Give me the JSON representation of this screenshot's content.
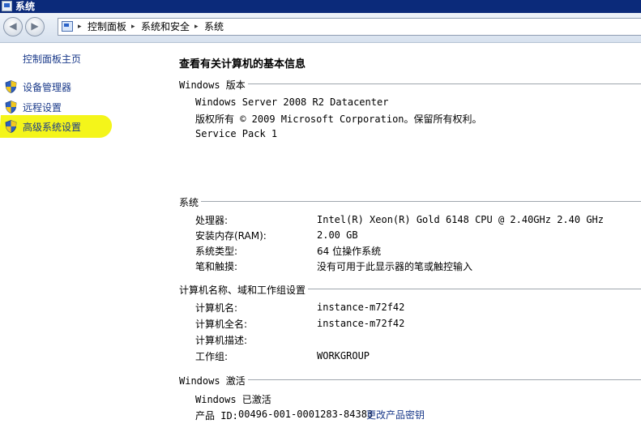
{
  "window": {
    "title": "系统"
  },
  "nav": {
    "breadcrumb": [
      "控制面板",
      "系统和安全",
      "系统"
    ],
    "separator": "▸"
  },
  "left": {
    "home": "控制面板主页",
    "items": [
      {
        "label": "设备管理器",
        "icon": "shield-icon"
      },
      {
        "label": "远程设置",
        "icon": "shield-icon"
      },
      {
        "label": "高级系统设置",
        "icon": "shield-icon",
        "highlighted": true
      }
    ]
  },
  "main": {
    "heading": "查看有关计算机的基本信息",
    "edition": {
      "title": "Windows 版本",
      "lines": [
        "Windows Server 2008 R2 Datacenter",
        "版权所有 © 2009 Microsoft Corporation。保留所有权利。",
        "Service Pack 1"
      ]
    },
    "system": {
      "title": "系统",
      "rows": [
        {
          "label": "处理器:",
          "value": "Intel(R) Xeon(R) Gold 6148 CPU @ 2.40GHz   2.40 GHz"
        },
        {
          "label": "安装内存(RAM):",
          "value": "2.00 GB"
        },
        {
          "label": "系统类型:",
          "value": "64 位操作系统"
        },
        {
          "label": "笔和触摸:",
          "value": "没有可用于此显示器的笔或触控输入"
        }
      ]
    },
    "computer": {
      "title": "计算机名称、域和工作组设置",
      "rows": [
        {
          "label": "计算机名:",
          "value": "instance-m72f42"
        },
        {
          "label": "计算机全名:",
          "value": "instance-m72f42"
        },
        {
          "label": "计算机描述:",
          "value": ""
        },
        {
          "label": "工作组:",
          "value": "WORKGROUP"
        }
      ]
    },
    "activation": {
      "title": "Windows 激活",
      "status": "Windows 已激活",
      "product_id_label": "产品 ID:",
      "product_id": "00496-001-0001283-84383",
      "change_key": "更改产品密钥"
    }
  },
  "colors": {
    "titlebar": "#0b2a7a",
    "link": "#1a3a8a",
    "highlight": "#f4f51a"
  }
}
